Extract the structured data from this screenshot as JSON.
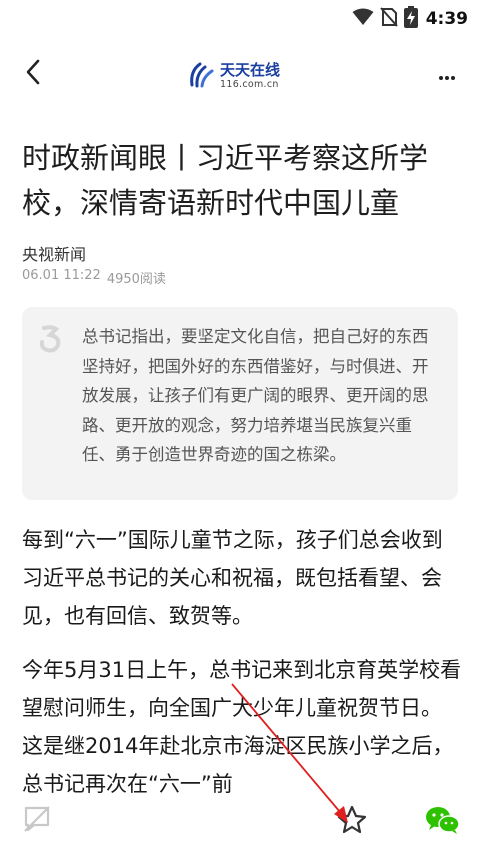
{
  "status_bar": {
    "time": "4:39"
  },
  "brand": {
    "name": "天天在线",
    "domain": "116.com.cn"
  },
  "article": {
    "title": "时政新闻眼丨习近平考察这所学校，深情寄语新时代中国儿童",
    "source": "央视新闻",
    "date": "06.01 11:22",
    "reads": "4950阅读",
    "quote": "总书记指出，要坚定文化自信，把自己好的东西坚持好，把国外好的东西借鉴好，与时俱进、开放发展，让孩子们有更广阔的眼界、更开阔的思路、更开放的观念，努力培养堪当民族复兴重任、勇于创造世界奇迹的国之栋梁。",
    "paragraph1": "每到“六一”国际儿童节之际，孩子们总会收到习近平总书记的关心和祝福，既包括看望、会见，也有回信、致贺等。",
    "paragraph2": "今年5月31日上午，总书记来到北京育英学校看望慰问师生，向全国广大少年儿童祝贺节日。这是继2014年赴北京市海淀区民族小学之后，总书记再次在“六一”前"
  },
  "colors": {
    "brand_blue": "#1a3fa0",
    "annotation_red": "#e02020",
    "wechat_green": "#2dc100",
    "quote_bg": "#f3f3f3"
  },
  "icons": {
    "back": "chevron-left-icon",
    "more": "more-dots-icon",
    "quote": "quote-mark-icon",
    "comment": "comment-off-icon",
    "favorite": "star-icon",
    "share": "wechat-icon"
  }
}
